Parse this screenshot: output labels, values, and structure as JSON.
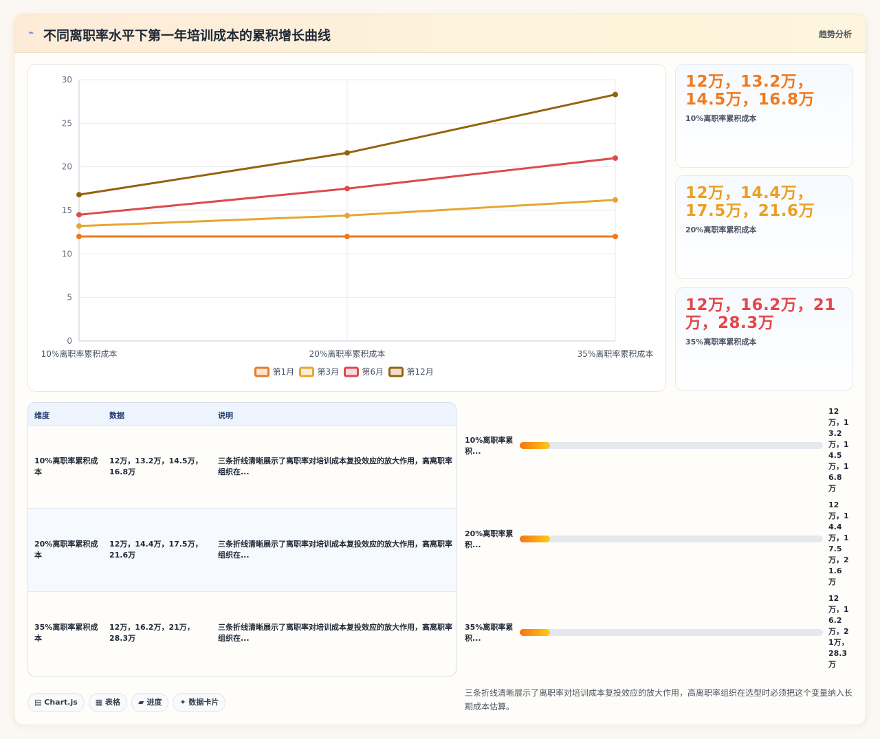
{
  "header": {
    "icon": "chart-line-icon",
    "title": "不同离职率水平下第一年培训成本的累积增长曲线",
    "tag": "趋势分析"
  },
  "chart_data": {
    "type": "line",
    "categories": [
      "10%离职率累积成本",
      "20%离职率累积成本",
      "35%离职率累积成本"
    ],
    "series": [
      {
        "name": "第1月",
        "values": [
          12,
          12,
          12
        ],
        "color": "#ea7a23"
      },
      {
        "name": "第3月",
        "values": [
          13.2,
          14.4,
          16.2
        ],
        "color": "#e8a530"
      },
      {
        "name": "第6月",
        "values": [
          14.5,
          17.5,
          21
        ],
        "color": "#dc4a4d"
      },
      {
        "name": "第12月",
        "values": [
          16.8,
          21.6,
          28.3
        ],
        "color": "#94620f"
      }
    ],
    "ylim": [
      0,
      30
    ],
    "yticks": [
      "0",
      "5",
      "10",
      "15",
      "20",
      "25",
      "30"
    ],
    "grid": true,
    "legend": "bottom"
  },
  "stats": [
    {
      "value": "12万，13.2万，14.5万，16.8万",
      "label": "10%离职率累积成本",
      "color": "#f07a1f"
    },
    {
      "value": "12万，14.4万，17.5万，21.6万",
      "label": "20%离职率累积成本",
      "color": "#eb9f22"
    },
    {
      "value": "12万，16.2万，21万，28.3万",
      "label": "35%离职率累积成本",
      "color": "#e0484b"
    }
  ],
  "table": {
    "headers": [
      "维度",
      "数据",
      "说明"
    ],
    "rows": [
      {
        "dim": "10%离职率累积成本",
        "data": "12万，13.2万，14.5万，16.8万",
        "desc": "三条折线清晰展示了离职率对培训成本复投效应的放大作用，高离职率组织在..."
      },
      {
        "dim": "20%离职率累积成本",
        "data": "12万，14.4万，17.5万，21.6万",
        "desc": "三条折线清晰展示了离职率对培训成本复投效应的放大作用，高离职率组织在..."
      },
      {
        "dim": "35%离职率累积成本",
        "data": "12万，16.2万，21万，28.3万",
        "desc": "三条折线清晰展示了离职率对培训成本复投效应的放大作用，高离职率组织在..."
      }
    ]
  },
  "progress": [
    {
      "label": "10%离职率累积...",
      "value": "12万，13.2万，14.5万，16.8万",
      "fraction": 0.1
    },
    {
      "label": "20%离职率累积...",
      "value": "12万，14.4万，17.5万，21.6万",
      "fraction": 0.1
    },
    {
      "label": "35%离职率累积...",
      "value": "12万，16.2万，21万，28.3万",
      "fraction": 0.1
    }
  ],
  "pills": [
    {
      "icon": "chart-icon",
      "glyph": "▤",
      "label": "Chart.js"
    },
    {
      "icon": "table-icon",
      "glyph": "▦",
      "label": "表格"
    },
    {
      "icon": "progress-icon",
      "glyph": "▰",
      "label": "进度"
    },
    {
      "icon": "sparkle-icon",
      "glyph": "✦",
      "label": "数据卡片"
    }
  ],
  "note": "三条折线清晰展示了离职率对培训成本复投效应的放大作用，高离职率组织在选型时必须把这个变量纳入长期成本估算。"
}
